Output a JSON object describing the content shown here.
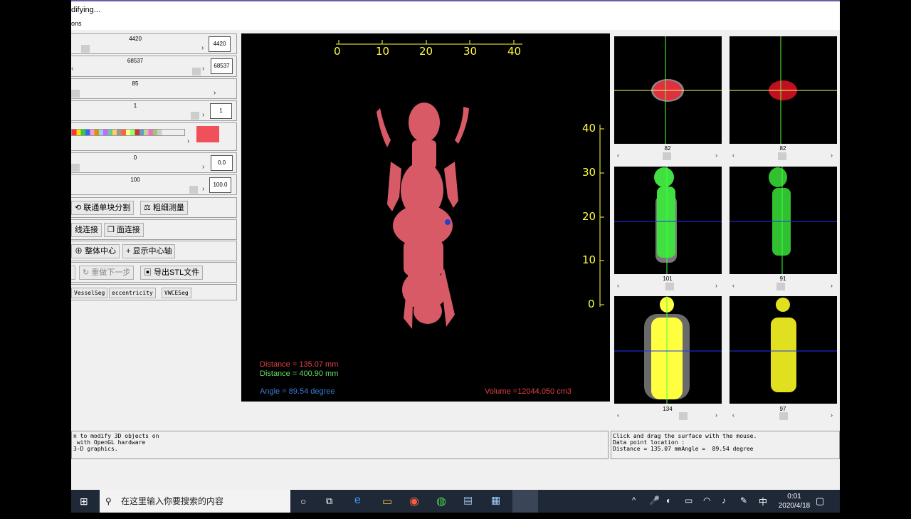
{
  "window": {
    "title": "difying...",
    "menu": "ons"
  },
  "controls": {
    "row1": {
      "label": "4420",
      "value": "4420"
    },
    "row2": {
      "label": "68537",
      "value": "68537"
    },
    "row3": {
      "label": "85"
    },
    "row4": {
      "label": "1",
      "value": "1"
    },
    "row6": {
      "label": "0",
      "value": "0.0"
    },
    "row7": {
      "label": "100",
      "value": "100.0"
    },
    "color_swatch": "#f0505a"
  },
  "buttons": {
    "connect_seg": "联通单块分割",
    "fine_measure": "粗细测量",
    "line_connect": "线连接",
    "face_connect": "面连接",
    "whole_center": "整体中心",
    "show_axis": "显示中心轴",
    "redo": "重做下一步",
    "export_stl": "导出STL文件",
    "vessel_seg": "VesselSeg",
    "eccentricity": "eccentricity",
    "vwce_seg": "VWCESeg"
  },
  "viewport": {
    "top_ruler": [
      "0",
      "10",
      "20",
      "30",
      "40"
    ],
    "side_ruler": [
      "40",
      "30",
      "20",
      "10",
      "0"
    ],
    "distance_red": "Distance = 135.07 mm",
    "distance_green": "Distance = 400.90 mm",
    "angle": "Angle =  89.54 degree",
    "volume": "Volume =12044.050 cm3",
    "colors": {
      "body": "#d85a66",
      "ruler": "#ffff40",
      "red_text": "#e04040",
      "green_text": "#60e060",
      "blue_text": "#3a7ad8"
    }
  },
  "slices": [
    {
      "num": "82"
    },
    {
      "num": "82"
    },
    {
      "num": "101"
    },
    {
      "num": "91"
    },
    {
      "num": "134"
    },
    {
      "num": "97"
    }
  ],
  "messages": {
    "left": "n to modify 3D objects on\n with OpenGL hardware\n3-D graphics.",
    "right": "Click and drag the surface with the mouse.\nData point location :\nDistance = 135.07 mmAngle =  89.54 degree"
  },
  "taskbar": {
    "search_placeholder": "在这里输入你要搜索的内容",
    "time": "0:01",
    "date": "2020/4/18",
    "ime": "中"
  }
}
